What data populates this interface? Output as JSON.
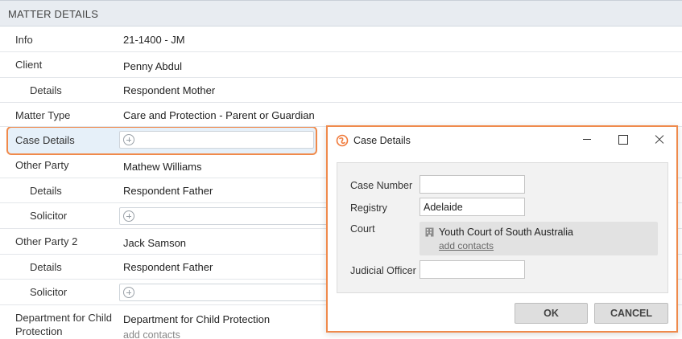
{
  "section": {
    "title": "MATTER DETAILS"
  },
  "rows": {
    "info": {
      "label": "Info",
      "value": "21-1400 - JM"
    },
    "client": {
      "label": "Client",
      "value": "Penny Abdul"
    },
    "client_details": {
      "label": "Details",
      "value": "Respondent Mother"
    },
    "matter_type": {
      "label": "Matter Type",
      "value": "Care and Protection - Parent or Guardian"
    },
    "case_details": {
      "label": "Case Details"
    },
    "other_party": {
      "label": "Other Party",
      "value": "Mathew Williams"
    },
    "other_party_details": {
      "label": "Details",
      "value": "Respondent Father"
    },
    "other_party_solicitor": {
      "label": "Solicitor"
    },
    "other_party2": {
      "label": "Other Party 2",
      "value": "Jack Samson"
    },
    "other_party2_details": {
      "label": "Details",
      "value": "Respondent Father"
    },
    "other_party2_solicitor": {
      "label": "Solicitor"
    },
    "department": {
      "label": "Department for Child Protection",
      "value": "Department for Child Protection",
      "link": "add contacts"
    }
  },
  "dialog": {
    "title": "Case Details",
    "fields": {
      "case_number": {
        "label": "Case Number",
        "value": ""
      },
      "registry": {
        "label": "Registry",
        "value": "Adelaide"
      },
      "court": {
        "label": "Court",
        "value": "Youth Court of South Australia",
        "link": "add contacts"
      },
      "judicial_officer": {
        "label": "Judicial Officer",
        "value": ""
      }
    },
    "buttons": {
      "ok": "OK",
      "cancel": "CANCEL"
    }
  },
  "colors": {
    "accent": "#ef8a4c",
    "header_bg": "#e8ecf1",
    "highlight_bg": "#d2e4f4"
  },
  "icons": {
    "app_logo": "swirl-logo-icon",
    "building": "building-icon",
    "add": "plus-circle-icon"
  }
}
